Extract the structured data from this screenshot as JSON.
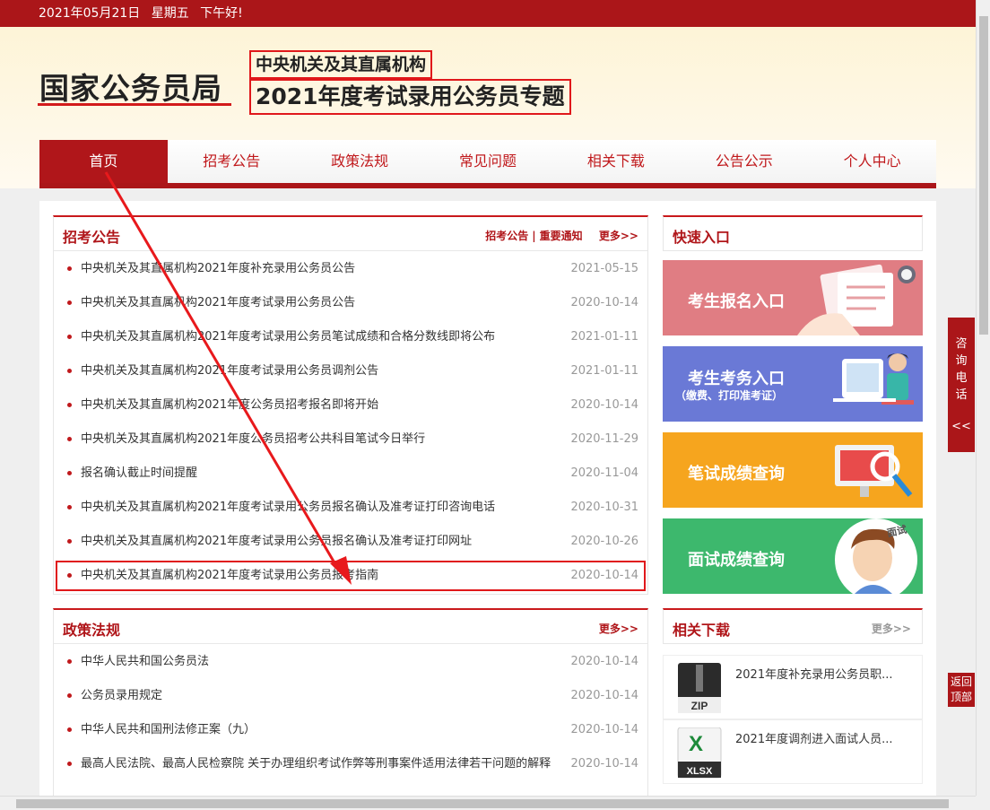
{
  "topbar": {
    "date": "2021年05月21日",
    "weekday": "星期五",
    "greeting": "下午好!"
  },
  "header": {
    "logo": "国家公务员局",
    "subtitle1": "中央机关及其直属机构",
    "subtitle2": "2021年度考试录用公务员专题"
  },
  "nav": [
    "首页",
    "招考公告",
    "政策法规",
    "常见问题",
    "相关下载",
    "公告公示",
    "个人中心"
  ],
  "notices": {
    "title": "招考公告",
    "link1": "招考公告",
    "link2": "重要通知",
    "more": "更多>>",
    "items": [
      {
        "text": "中央机关及其直属机构2021年度补充录用公务员公告",
        "date": "2021-05-15"
      },
      {
        "text": "中央机关及其直属机构2021年度考试录用公务员公告",
        "date": "2020-10-14"
      },
      {
        "text": "中央机关及其直属机构2021年度考试录用公务员笔试成绩和合格分数线即将公布",
        "date": "2021-01-11"
      },
      {
        "text": "中央机关及其直属机构2021年度考试录用公务员调剂公告",
        "date": "2021-01-11"
      },
      {
        "text": "中央机关及其直属机构2021年度公务员招考报名即将开始",
        "date": "2020-10-14"
      },
      {
        "text": "中央机关及其直属机构2021年度公务员招考公共科目笔试今日举行",
        "date": "2020-11-29"
      },
      {
        "text": "报名确认截止时间提醒",
        "date": "2020-11-04"
      },
      {
        "text": "中央机关及其直属机构2021年度考试录用公务员报名确认及准考证打印咨询电话",
        "date": "2020-10-31"
      },
      {
        "text": "中央机关及其直属机构2021年度考试录用公务员报名确认及准考证打印网址",
        "date": "2020-10-26"
      },
      {
        "text": "中央机关及其直属机构2021年度考试录用公务员报考指南",
        "date": "2020-10-14"
      }
    ]
  },
  "policy": {
    "title": "政策法规",
    "more": "更多>>",
    "items": [
      {
        "text": "中华人民共和国公务员法",
        "date": "2020-10-14"
      },
      {
        "text": "公务员录用规定",
        "date": "2020-10-14"
      },
      {
        "text": "中华人民共和国刑法修正案（九）",
        "date": "2020-10-14"
      },
      {
        "text": "最高人民法院、最高人民检察院 关于办理组织考试作弊等刑事案件适用法律若干问题的解释",
        "date": "2020-10-14"
      }
    ]
  },
  "quick": {
    "title": "快速入口",
    "b1": "考生报名入口",
    "b2": "考生考务入口",
    "b2sub": "（缴费、打印准考证）",
    "b3": "笔试成绩查询",
    "b4": "面试成绩查询",
    "b4badge": "面试"
  },
  "downloads": {
    "title": "相关下载",
    "more": "更多>>",
    "items": [
      {
        "name": "2021年度补充录用公务员职...",
        "type": "ZIP"
      },
      {
        "name": "2021年度调剂进入面试人员...",
        "type": "XLSX"
      }
    ]
  },
  "side": {
    "consult": "咨询电话",
    "collapse": "<<",
    "backtop1": "返回",
    "backtop2": "顶部"
  }
}
